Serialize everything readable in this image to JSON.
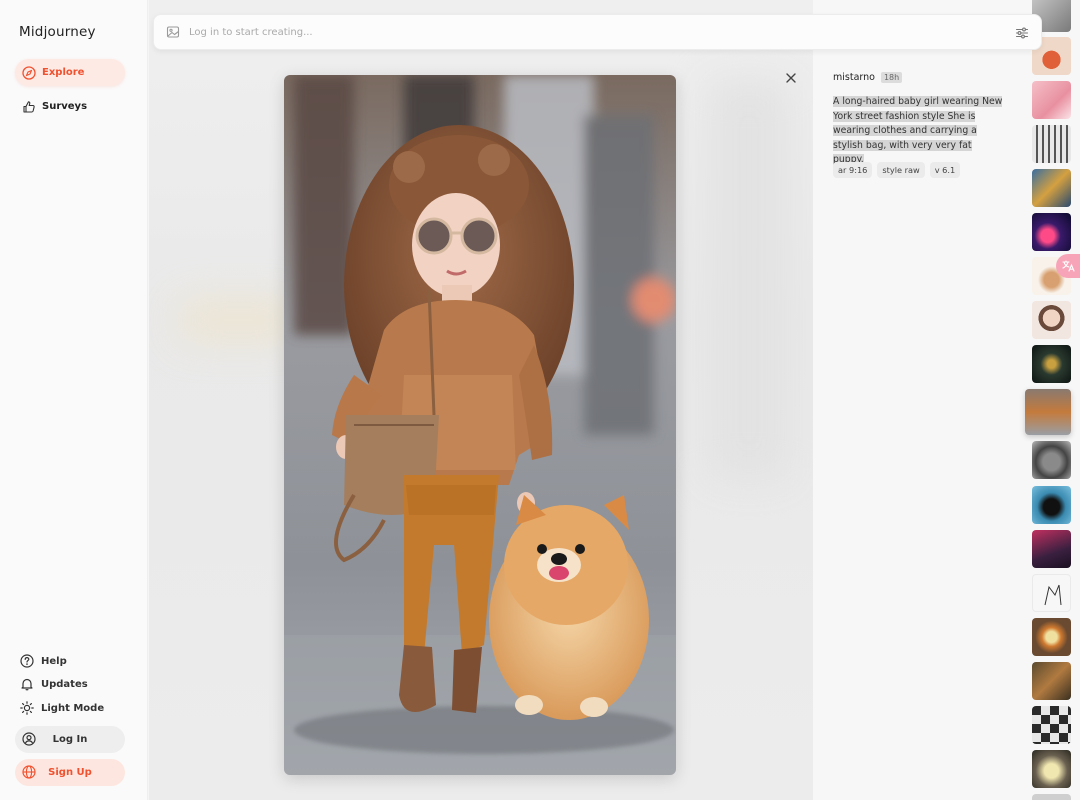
{
  "app": {
    "title": "Midjourney"
  },
  "sidebar": {
    "nav": [
      {
        "label": "Explore",
        "icon": "compass-icon",
        "active": true
      },
      {
        "label": "Surveys",
        "icon": "thumbs-up-icon",
        "active": false
      }
    ],
    "bottom": [
      {
        "label": "Help",
        "icon": "help-icon"
      },
      {
        "label": "Updates",
        "icon": "bell-icon"
      },
      {
        "label": "Light Mode",
        "icon": "sun-icon"
      }
    ],
    "login_label": "Log In",
    "signup_label": "Sign Up"
  },
  "search": {
    "placeholder": "Log in to start creating..."
  },
  "details": {
    "author": "mistarno",
    "time": "18h",
    "prompt": "A long-haired baby girl wearing New York street fashion style She is wearing clothes and carrying a stylish bag, with very very fat puppy.",
    "tags": [
      "ar 9:16",
      "style raw",
      "v 6.1"
    ]
  },
  "thumbnails": [
    {
      "icon": "thumbnail-image"
    },
    {
      "icon": "thumbnail-image"
    },
    {
      "icon": "thumbnail-image"
    },
    {
      "icon": "thumbnail-image"
    },
    {
      "icon": "thumbnail-image"
    },
    {
      "icon": "thumbnail-image"
    },
    {
      "icon": "thumbnail-image"
    },
    {
      "icon": "thumbnail-image"
    },
    {
      "icon": "thumbnail-image"
    },
    {
      "icon": "thumbnail-image",
      "selected": true
    },
    {
      "icon": "thumbnail-image"
    },
    {
      "icon": "thumbnail-image"
    },
    {
      "icon": "thumbnail-image"
    },
    {
      "icon": "thumbnail-image"
    },
    {
      "icon": "thumbnail-image"
    },
    {
      "icon": "thumbnail-image"
    },
    {
      "icon": "thumbnail-image"
    },
    {
      "icon": "thumbnail-image"
    },
    {
      "icon": "thumbnail-image"
    }
  ],
  "colors": {
    "accent": "#f0512f",
    "accent_bg": "#fdeae5"
  }
}
